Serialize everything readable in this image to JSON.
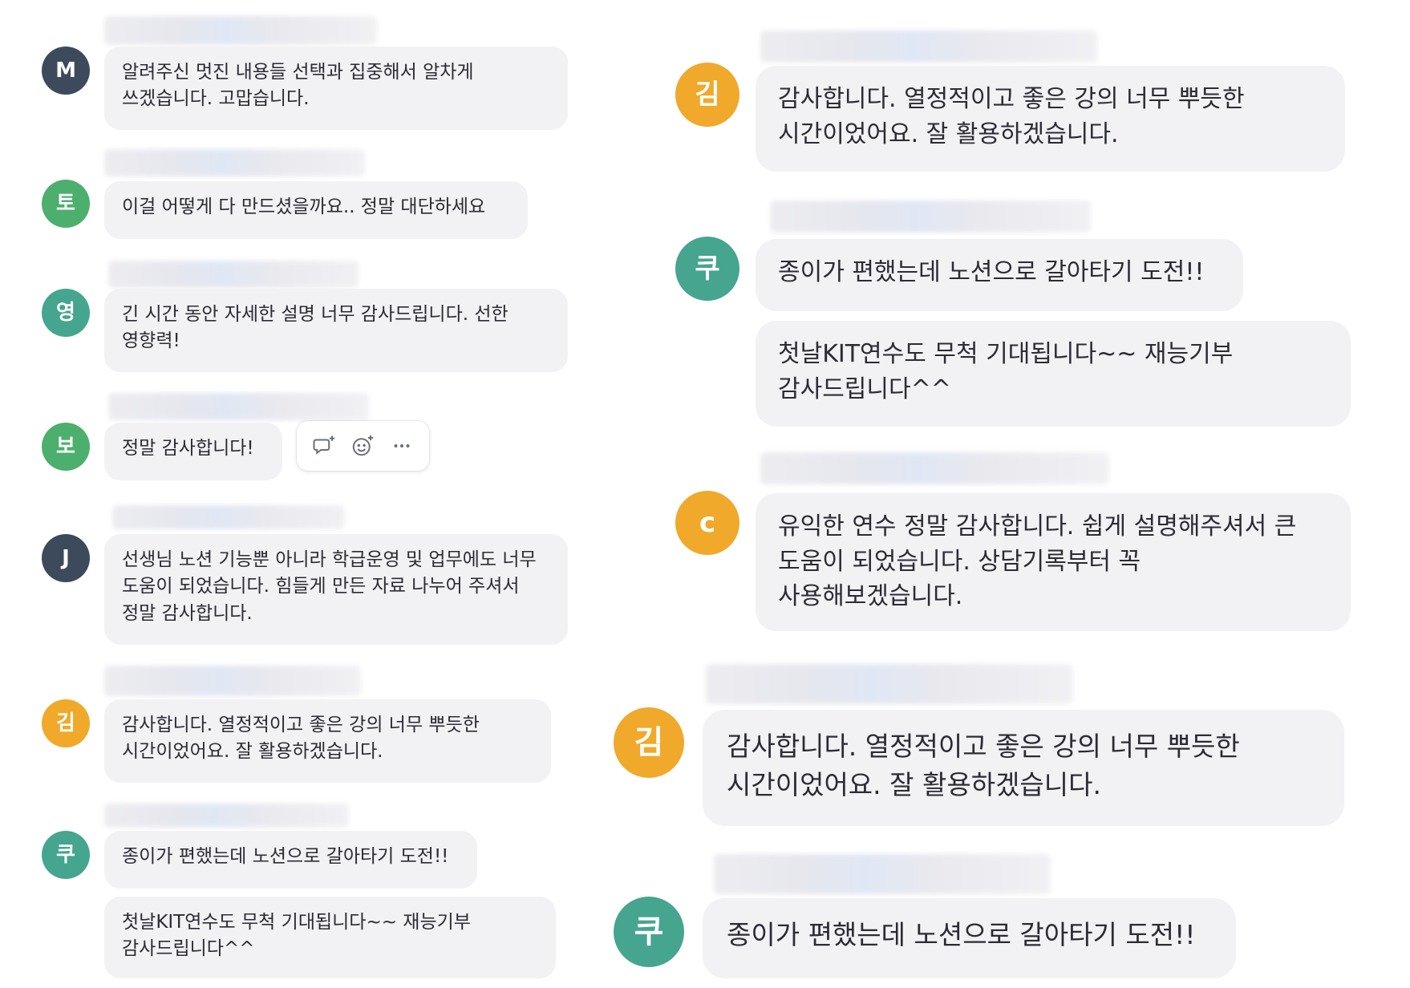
{
  "messages": [
    {
      "avatar": "M",
      "text": "알려주신 멋진 내용들 선택과 집중해서 알차게 쓰겠습니다. 고맙습니다."
    },
    {
      "avatar": "토",
      "text": "이걸 어떻게 다 만드셨을까요.. 정말 대단하세요"
    },
    {
      "avatar": "영",
      "text": "긴 시간 동안 자세한 설명 너무 감사드립니다. 선한 영향력!"
    },
    {
      "avatar": "보",
      "text": "정말 감사합니다!"
    },
    {
      "avatar": "J",
      "text": "선생님 노션 기능뿐 아니라 학급운영 및 업무에도 너무 도움이 되었습니다. 힘들게 만든 자료 나누어 주셔서 정말 감사합니다."
    },
    {
      "avatar": "김",
      "text": "감사합니다. 열정적이고 좋은 강의 너무 뿌듯한 시간이었어요. 잘 활용하겠습니다."
    },
    {
      "avatar": "쿠",
      "text": "종이가 편했는데 노션으로 갈아타기 도전!!",
      "text2": "첫날KIT연수도 무척 기대됩니다~~ 재능기부 감사드립니다^^"
    },
    {
      "avatar": "김",
      "text": "감사합니다. 열정적이고 좋은 강의 너무 뿌듯한 시간이었어요. 잘 활용하겠습니다."
    },
    {
      "avatar": "쿠",
      "text": "종이가 편했는데 노션으로 갈아타기 도전!!",
      "text2": "첫날KIT연수도 무척 기대됩니다~~ 재능기부 감사드립니다^^"
    },
    {
      "avatar": "c",
      "text": "유익한 연수 정말 감사합니다. 쉽게 설명해주셔서 큰 도움이 되었습니다. 상담기록부터 꼭 사용해보겠습니다."
    },
    {
      "avatar": "김",
      "text": "감사합니다. 열정적이고 좋은 강의 너무 뿌듯한 시간이었어요. 잘 활용하겠습니다."
    },
    {
      "avatar": "쿠",
      "text": "종이가 편했는데 노션으로 갈아타기 도전!!"
    }
  ],
  "hover_toolbar": {
    "icons": [
      "reply-thread-icon",
      "add-reaction-icon",
      "more-options-icon"
    ]
  },
  "colors": {
    "slate": "#3c4a5c",
    "green": "#4caf6d",
    "teal": "#46a58f",
    "orange": "#f0a92b",
    "bubble": "#f2f2f5"
  }
}
